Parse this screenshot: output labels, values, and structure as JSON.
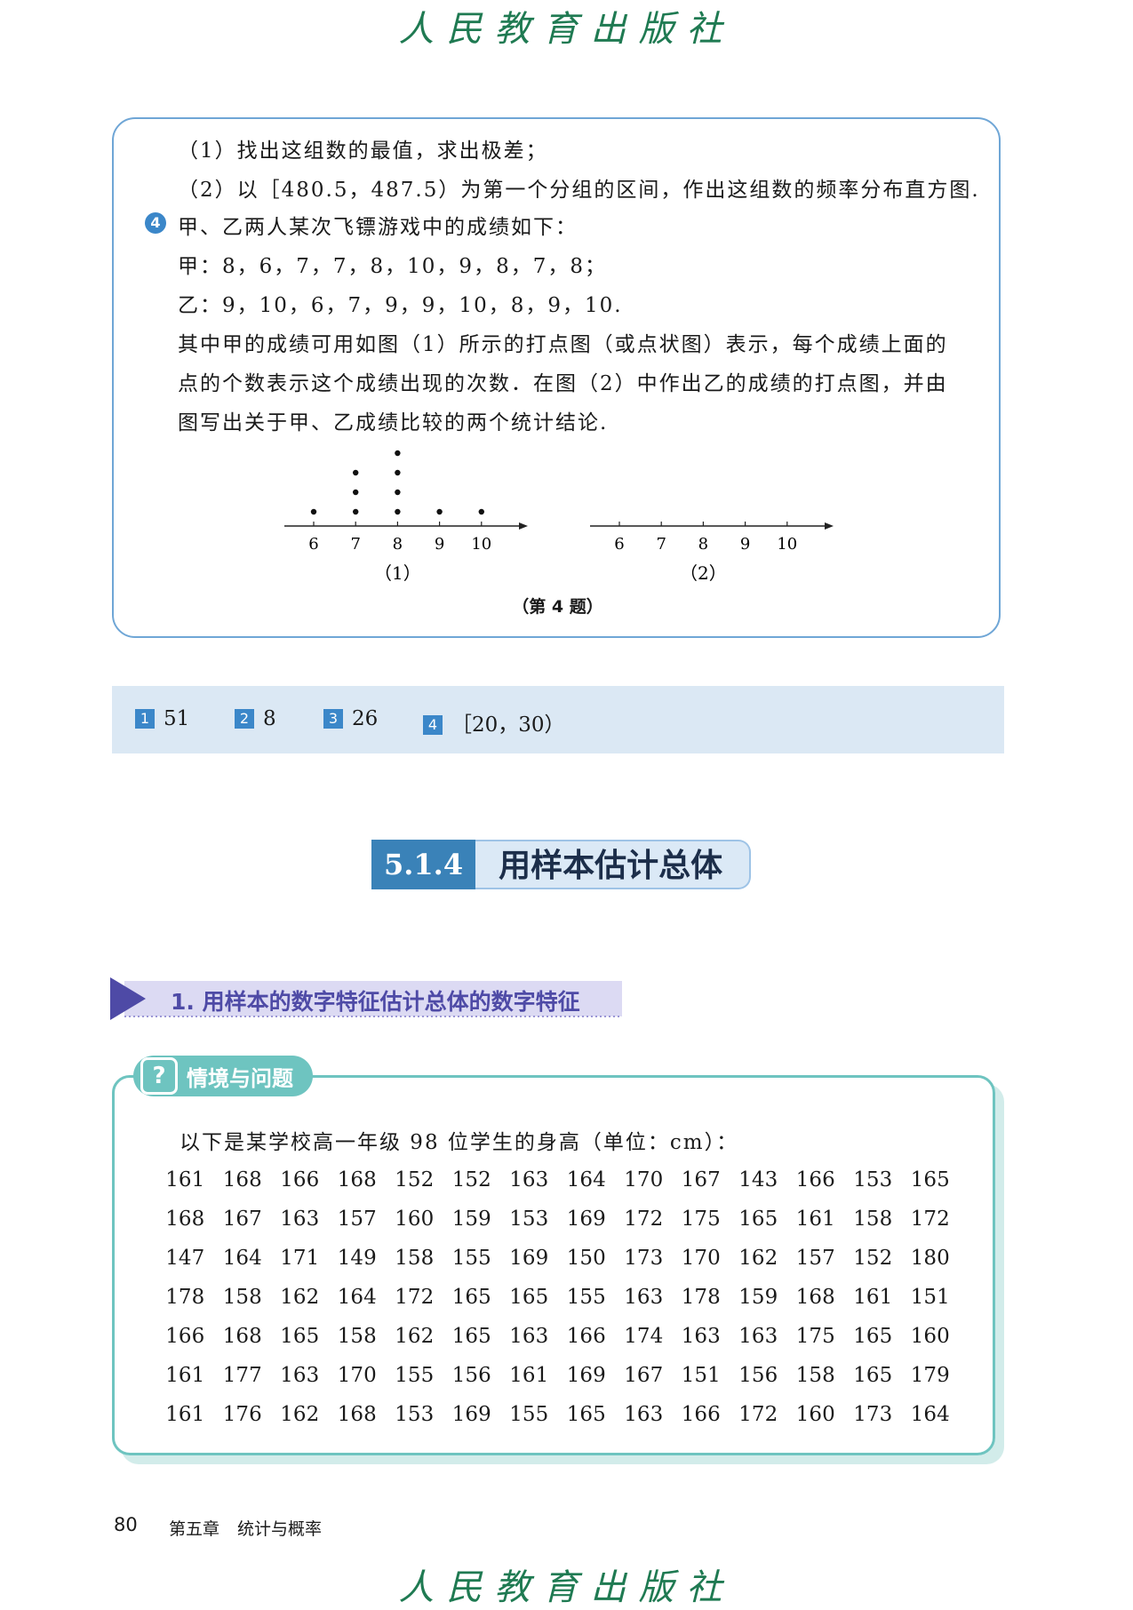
{
  "publisher": "人民教育出版社",
  "exercise": {
    "line1": "（1）找出这组数的最值，求出极差；",
    "line2": "（2）以［480.5，487.5）为第一个分组的区间，作出这组数的频率分布直方图.",
    "q4_number": "4",
    "q4_line1": "甲、乙两人某次飞镖游戏中的成绩如下：",
    "jia": "甲：8，6，7，7，8，10，9，8，7，8；",
    "yi": "乙：9，10，6，7，9，9，10，8，9，10.",
    "desc1": "其中甲的成绩可用如图（1）所示的打点图（或点状图）表示，每个成绩上面的",
    "desc2": "点的个数表示这个成绩出现的次数．在图（2）中作出乙的成绩的打点图，并由",
    "desc3": "图写出关于甲、乙成绩比较的两个统计结论.",
    "caption": "（第 4 题）"
  },
  "chart_data": [
    {
      "type": "scatter",
      "title": "（1）",
      "x_ticks": [
        6,
        7,
        8,
        9,
        10
      ],
      "values": [
        {
          "x": 6,
          "count": 1
        },
        {
          "x": 7,
          "count": 3
        },
        {
          "x": 8,
          "count": 4
        },
        {
          "x": 9,
          "count": 1
        },
        {
          "x": 10,
          "count": 1
        }
      ]
    },
    {
      "type": "scatter",
      "title": "（2）",
      "x_ticks": [
        6,
        7,
        8,
        9,
        10
      ],
      "values": []
    }
  ],
  "answers": [
    {
      "tag": "1",
      "value": "51"
    },
    {
      "tag": "2",
      "value": "8"
    },
    {
      "tag": "3",
      "value": "26"
    },
    {
      "tag": "4",
      "value": "［20，30）"
    }
  ],
  "section": {
    "number": "5.1.4",
    "title": "用样本估计总体"
  },
  "subsection": "1. 用样本的数字特征估计总体的数字特征",
  "situation": {
    "icon": "?",
    "label": "情境与问题",
    "intro": "以下是某学校高一年级 98 位学生的身高（单位：cm）：",
    "heights": [
      [
        "161",
        "168",
        "166",
        "168",
        "152",
        "152",
        "163",
        "164",
        "170",
        "167",
        "143",
        "166",
        "153",
        "165"
      ],
      [
        "168",
        "167",
        "163",
        "157",
        "160",
        "159",
        "153",
        "169",
        "172",
        "175",
        "165",
        "161",
        "158",
        "172"
      ],
      [
        "147",
        "164",
        "171",
        "149",
        "158",
        "155",
        "169",
        "150",
        "173",
        "170",
        "162",
        "157",
        "152",
        "180"
      ],
      [
        "178",
        "158",
        "162",
        "164",
        "172",
        "165",
        "165",
        "155",
        "163",
        "178",
        "159",
        "168",
        "161",
        "151"
      ],
      [
        "166",
        "168",
        "165",
        "158",
        "162",
        "165",
        "163",
        "166",
        "174",
        "163",
        "163",
        "175",
        "165",
        "160"
      ],
      [
        "161",
        "177",
        "163",
        "170",
        "155",
        "156",
        "161",
        "169",
        "167",
        "151",
        "156",
        "158",
        "165",
        "179"
      ],
      [
        "161",
        "176",
        "162",
        "168",
        "153",
        "169",
        "155",
        "165",
        "163",
        "166",
        "172",
        "160",
        "173",
        "164"
      ]
    ]
  },
  "footer": {
    "page": "80",
    "chapter": "第五章",
    "chapter_title": "统计与概率"
  },
  "colors": {
    "blue": "#3b87c9",
    "teal": "#6ec4c0",
    "purple": "#4e4aa6",
    "publisher_green": "#1f7a52"
  }
}
